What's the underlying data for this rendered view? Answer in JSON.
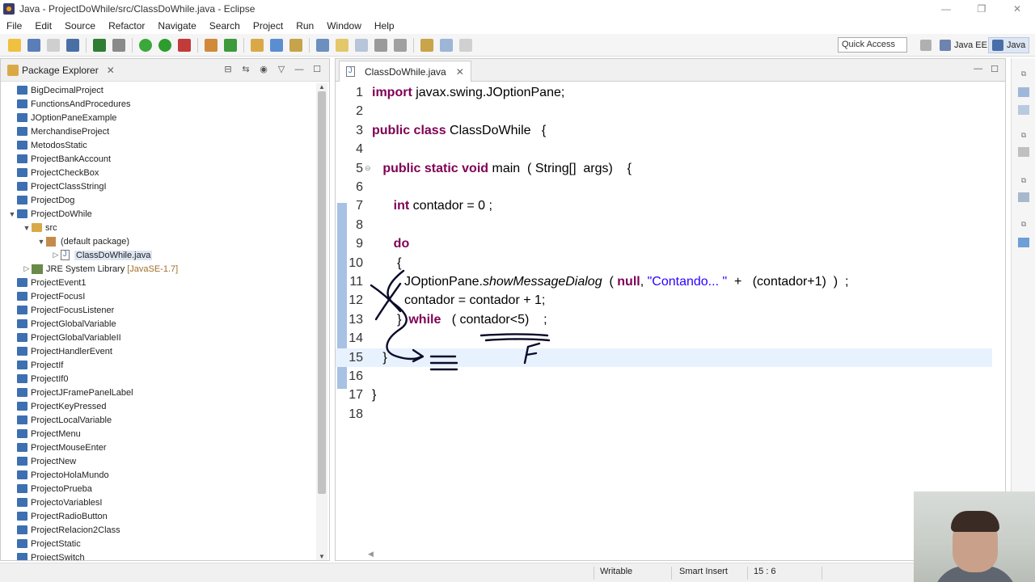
{
  "window": {
    "title": "Java - ProjectDoWhile/src/ClassDoWhile.java - Eclipse"
  },
  "menu": [
    "File",
    "Edit",
    "Source",
    "Refactor",
    "Navigate",
    "Search",
    "Project",
    "Run",
    "Window",
    "Help"
  ],
  "toolbar": {
    "quick_access": "Quick Access",
    "perspectives": [
      "Java EE",
      "Java"
    ]
  },
  "package_explorer": {
    "title": "Package Explorer",
    "items": [
      {
        "label": "BigDecimalProject",
        "type": "project",
        "depth": 0
      },
      {
        "label": "FunctionsAndProcedures",
        "type": "project",
        "depth": 0
      },
      {
        "label": "JOptionPaneExample",
        "type": "project",
        "depth": 0
      },
      {
        "label": "MerchandiseProject",
        "type": "project",
        "depth": 0
      },
      {
        "label": "MetodosStatic",
        "type": "project",
        "depth": 0
      },
      {
        "label": "ProjectBankAccount",
        "type": "project",
        "depth": 0
      },
      {
        "label": "ProjectCheckBox",
        "type": "project",
        "depth": 0
      },
      {
        "label": "ProjectClassStringI",
        "type": "project",
        "depth": 0
      },
      {
        "label": "ProjectDog",
        "type": "project",
        "depth": 0
      },
      {
        "label": "ProjectDoWhile",
        "type": "project",
        "depth": 0,
        "expanded": true
      },
      {
        "label": "src",
        "type": "folder",
        "depth": 1,
        "expanded": true
      },
      {
        "label": "(default package)",
        "type": "package",
        "depth": 2,
        "expanded": true
      },
      {
        "label": "ClassDoWhile.java",
        "type": "java",
        "depth": 3,
        "selected": true
      },
      {
        "label": "JRE System Library",
        "decoration": "[JavaSE-1.7]",
        "type": "library",
        "depth": 1
      },
      {
        "label": "ProjectEvent1",
        "type": "project",
        "depth": 0
      },
      {
        "label": "ProjectFocusI",
        "type": "project",
        "depth": 0
      },
      {
        "label": "ProjectFocusListener",
        "type": "project",
        "depth": 0
      },
      {
        "label": "ProjectGlobalVariable",
        "type": "project",
        "depth": 0
      },
      {
        "label": "ProjectGlobalVariableII",
        "type": "project",
        "depth": 0
      },
      {
        "label": "ProjectHandlerEvent",
        "type": "project",
        "depth": 0
      },
      {
        "label": "ProjectIf",
        "type": "project",
        "depth": 0
      },
      {
        "label": "ProjectIf0",
        "type": "project",
        "depth": 0
      },
      {
        "label": "ProjectJFramePanelLabel",
        "type": "project",
        "depth": 0
      },
      {
        "label": "ProjectKeyPressed",
        "type": "project",
        "depth": 0
      },
      {
        "label": "ProjectLocalVariable",
        "type": "project",
        "depth": 0
      },
      {
        "label": "ProjectMenu",
        "type": "project",
        "depth": 0
      },
      {
        "label": "ProjectMouseEnter",
        "type": "project",
        "depth": 0
      },
      {
        "label": "ProjectNew",
        "type": "project",
        "depth": 0
      },
      {
        "label": "ProjectoHolaMundo",
        "type": "project",
        "depth": 0
      },
      {
        "label": "ProjectoPrueba",
        "type": "project",
        "depth": 0
      },
      {
        "label": "ProjectoVariablesI",
        "type": "project",
        "depth": 0
      },
      {
        "label": "ProjectRadioButton",
        "type": "project",
        "depth": 0
      },
      {
        "label": "ProjectRelacion2Class",
        "type": "project",
        "depth": 0
      },
      {
        "label": "ProjectStatic",
        "type": "project",
        "depth": 0
      },
      {
        "label": "ProjectSwitch",
        "type": "project",
        "depth": 0
      }
    ]
  },
  "editor": {
    "tab_label": "ClassDoWhile.java",
    "current_line": 15,
    "lines": [
      {
        "n": "1",
        "parts": [
          {
            "t": "import ",
            "k": "kw"
          },
          {
            "t": "javax.swing.JOptionPane;"
          }
        ]
      },
      {
        "n": "2",
        "parts": []
      },
      {
        "n": "3",
        "parts": [
          {
            "t": "public class ",
            "k": "kw"
          },
          {
            "t": "ClassDoWhile   {"
          }
        ]
      },
      {
        "n": "4",
        "parts": []
      },
      {
        "n": "5",
        "parts": [
          {
            "t": "   "
          },
          {
            "t": "public static void ",
            "k": "kw"
          },
          {
            "t": "main  ( String[]  args)    {"
          }
        ]
      },
      {
        "n": "6",
        "parts": []
      },
      {
        "n": "7",
        "parts": [
          {
            "t": "      "
          },
          {
            "t": "int ",
            "k": "kw"
          },
          {
            "t": "contador = 0 ;"
          }
        ]
      },
      {
        "n": "8",
        "parts": []
      },
      {
        "n": "9",
        "parts": [
          {
            "t": "      "
          },
          {
            "t": "do",
            "k": "kw"
          }
        ]
      },
      {
        "n": "10",
        "parts": [
          {
            "t": "       {"
          }
        ]
      },
      {
        "n": "11",
        "parts": [
          {
            "t": "         JOptionPane."
          },
          {
            "t": "showMessageDialog",
            "k": "ital"
          },
          {
            "t": "  ( "
          },
          {
            "t": "null",
            "k": "kw"
          },
          {
            "t": ", "
          },
          {
            "t": "\"Contando... \"",
            "k": "str"
          },
          {
            "t": "  +   (contador+1)  )  ;"
          }
        ]
      },
      {
        "n": "12",
        "parts": [
          {
            "t": "         contador = contador + 1;"
          }
        ]
      },
      {
        "n": "13",
        "parts": [
          {
            "t": "       }  "
          },
          {
            "t": "while",
            "k": "kw"
          },
          {
            "t": "   ( contador<5)    ;"
          }
        ]
      },
      {
        "n": "14",
        "parts": []
      },
      {
        "n": "15",
        "parts": [
          {
            "t": "   }"
          }
        ]
      },
      {
        "n": "16",
        "parts": []
      },
      {
        "n": "17",
        "parts": [
          {
            "t": "}"
          }
        ]
      },
      {
        "n": "18",
        "parts": []
      }
    ]
  },
  "status": {
    "writable": "Writable",
    "insert_mode": "Smart Insert",
    "position": "15 : 6"
  }
}
